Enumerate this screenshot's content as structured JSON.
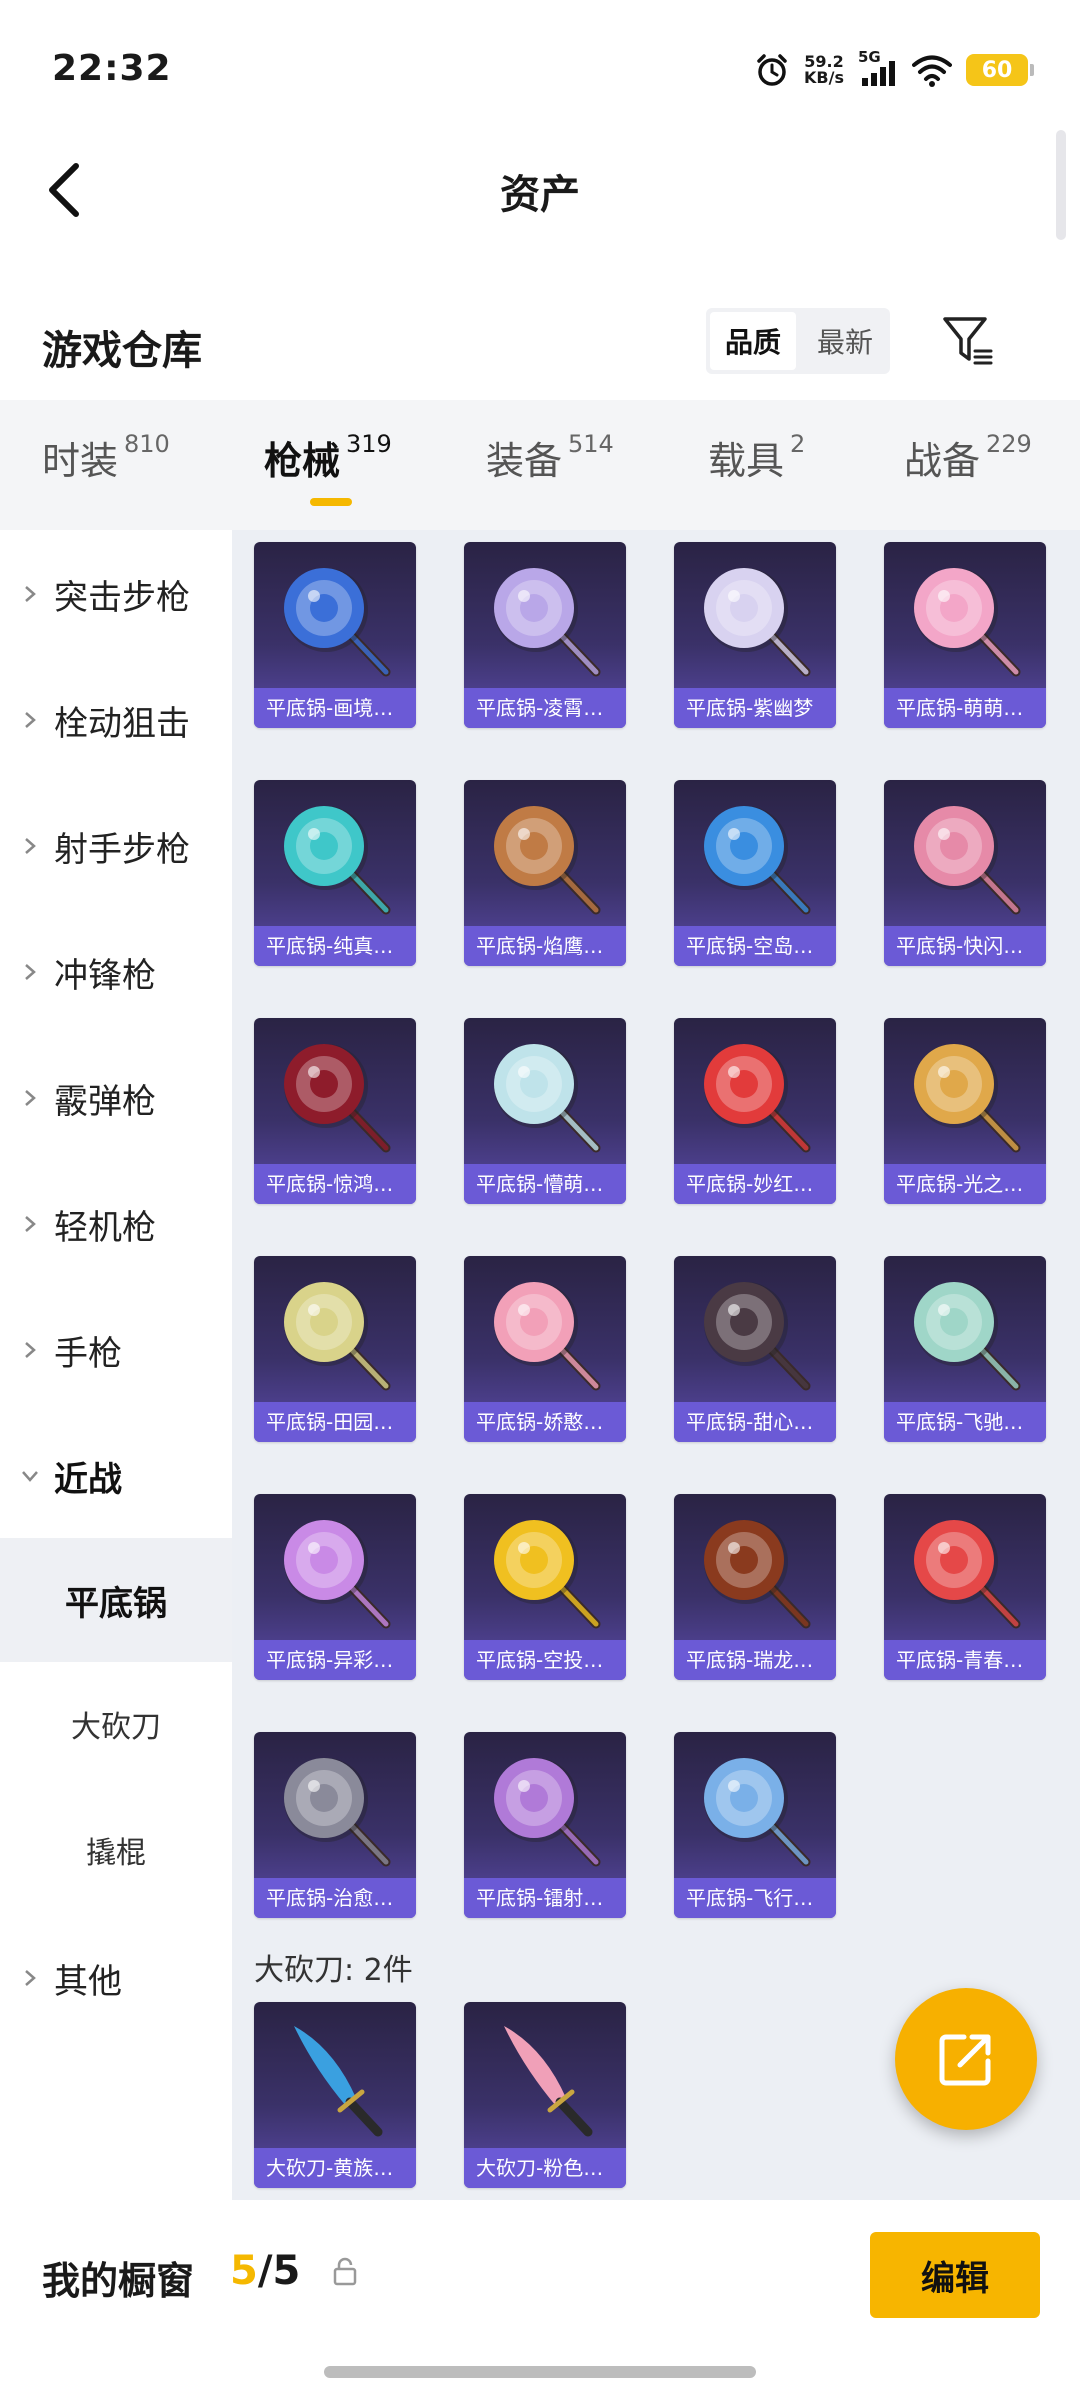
{
  "status_bar": {
    "time": "22:32",
    "net_speed_value": "59.2",
    "net_speed_unit": "KB/s",
    "network": "5G",
    "battery": "60",
    "icons": [
      "alarm-icon",
      "signal-icon",
      "wifi-icon",
      "battery-icon"
    ],
    "battery_color": "#f5c518"
  },
  "nav": {
    "title": "资产"
  },
  "warehouse": {
    "title": "游戏仓库",
    "sort_options": [
      "品质",
      "最新"
    ],
    "sort_selected": "品质"
  },
  "tabs": [
    {
      "label": "时装",
      "count": "810"
    },
    {
      "label": "枪械",
      "count": "319",
      "active": true
    },
    {
      "label": "装备",
      "count": "514"
    },
    {
      "label": "载具",
      "count": "2"
    },
    {
      "label": "战备",
      "count": "229"
    }
  ],
  "sidebar": {
    "categories": [
      "突击步枪",
      "栓动狙击",
      "射手步枪",
      "冲锋枪",
      "霰弹枪",
      "轻机枪",
      "手枪",
      "近战"
    ],
    "melee_subitems": [
      "平底锅",
      "大砍刀",
      "撬棍"
    ],
    "active_subitem": "平底锅",
    "other": "其他"
  },
  "items": [
    "平底锅-画境…",
    "平底锅-凌霄…",
    "平底锅-紫幽梦",
    "平底锅-萌萌…",
    "平底锅-纯真…",
    "平底锅-焰鹰…",
    "平底锅-空岛…",
    "平底锅-快闪…",
    "平底锅-惊鸿…",
    "平底锅-懵萌…",
    "平底锅-妙红…",
    "平底锅-光之…",
    "平底锅-田园…",
    "平底锅-娇憨…",
    "平底锅-甜心…",
    "平底锅-飞驰…",
    "平底锅-异彩…",
    "平底锅-空投…",
    "平底锅-瑞龙…",
    "平底锅-青春…",
    "平底锅-治愈…",
    "平底锅-镭射…",
    "平底锅-飞行…"
  ],
  "item_colors": [
    "#3b6fd8",
    "#b9a7e8",
    "#d8d2f0",
    "#f3a6c8",
    "#3fc7c9",
    "#c07b45",
    "#3a8ee0",
    "#e68aa8",
    "#8e1c2b",
    "#bfe3ea",
    "#e23b3b",
    "#e0a84a",
    "#d9d38a",
    "#f2a0b8",
    "#4a3a44",
    "#9fd6c8",
    "#c98ae6",
    "#f0c020",
    "#8a3a1e",
    "#e54848",
    "#8a8a9a",
    "#b07ad8",
    "#7ab0e8"
  ],
  "section_machete": {
    "title": "大砍刀: 2件",
    "items": [
      "大砍刀-黄族…",
      "大砍刀-粉色…"
    ],
    "item_colors": [
      "#3aa0e0",
      "#f0a0b8"
    ]
  },
  "fab": {
    "icon": "share-icon",
    "color": "#f7b000"
  },
  "bottom_bar": {
    "label": "我的橱窗",
    "count_current": "5",
    "count_separator": "/",
    "count_total": "5",
    "edit_label": "编辑",
    "accent": "#f7b500"
  }
}
